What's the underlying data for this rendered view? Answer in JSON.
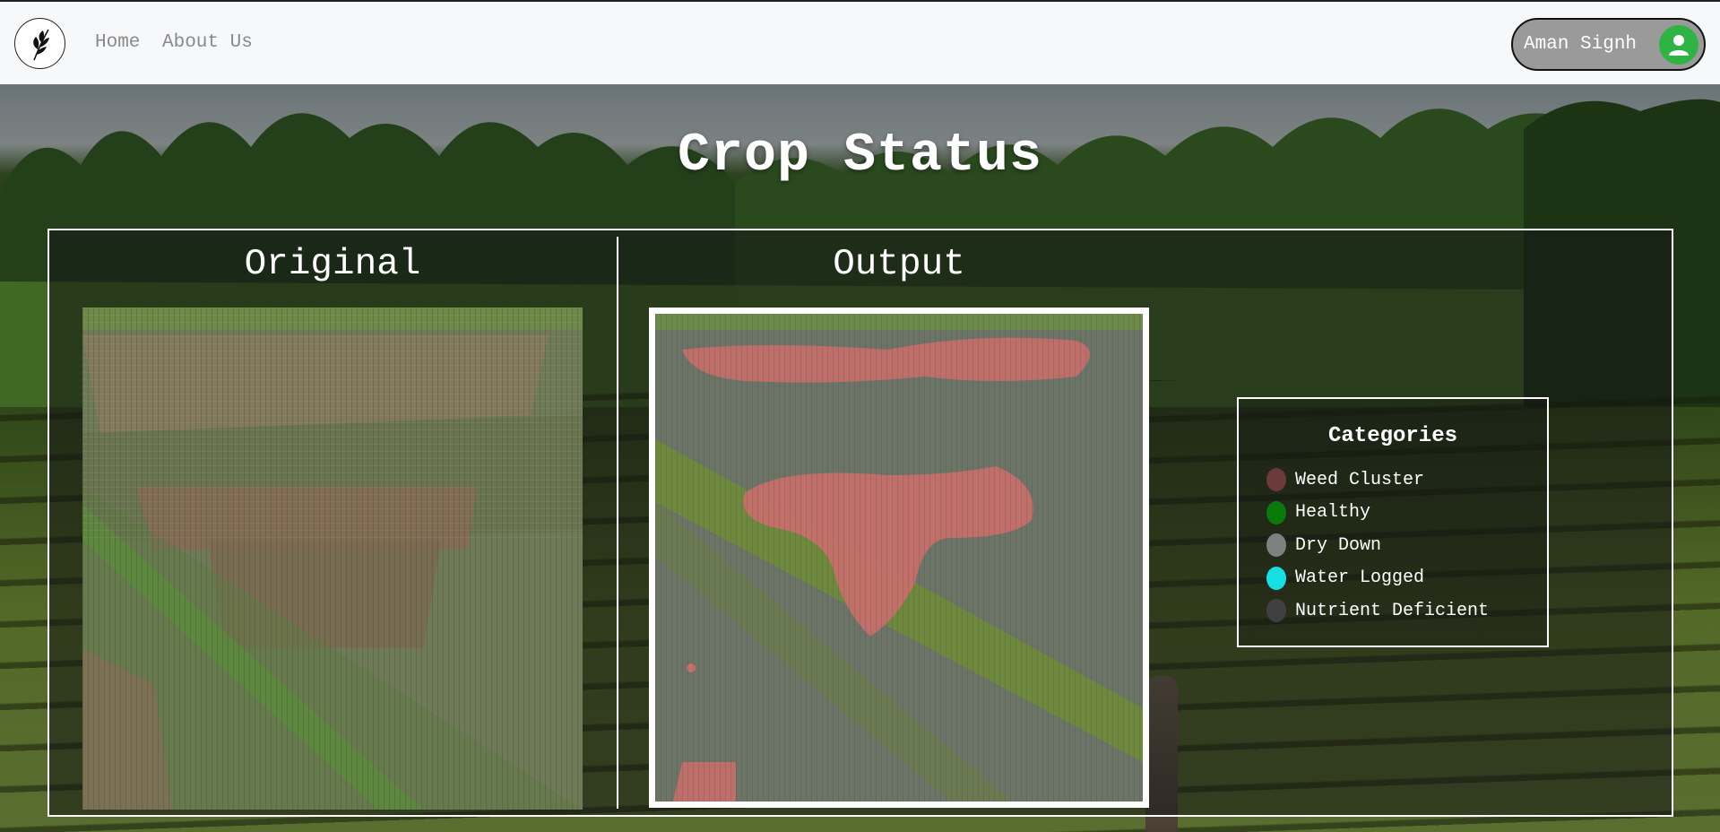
{
  "nav": {
    "links": [
      "Home",
      "About Us"
    ],
    "user_name": "Aman Signh"
  },
  "page": {
    "title": "Crop Status"
  },
  "panels": {
    "original_heading": "Original",
    "output_heading": "Output"
  },
  "legend": {
    "title": "Categories",
    "items": [
      {
        "label": "Weed Cluster",
        "color": "#6b3a3a"
      },
      {
        "label": "Healthy",
        "color": "#0a7a0a"
      },
      {
        "label": "Dry Down",
        "color": "#808080"
      },
      {
        "label": "Water Logged",
        "color": "#16e0e6"
      },
      {
        "label": "Nutrient Deficient",
        "color": "#404040"
      }
    ]
  },
  "colors": {
    "accent_green": "#2fb344",
    "nav_bg": "#f7f8fa",
    "user_pill_bg": "#9a9a9a"
  }
}
